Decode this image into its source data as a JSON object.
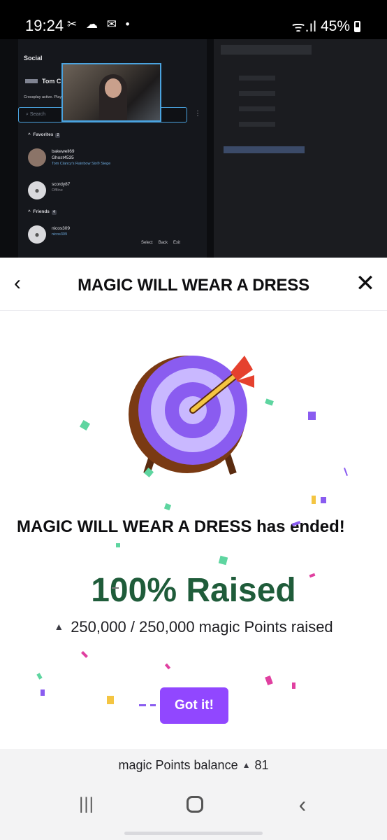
{
  "status_bar": {
    "time": "19:24",
    "notification_icons": "✂ ☁ ✉ •",
    "signal": "ᯤ.ıl",
    "battery": "45%"
  },
  "stream": {
    "social_title": "Social",
    "game_title": "Tom Clancy's Rainbow Six® Siege",
    "crossplay_text": "Crossplay active. Players from other platforms can be invited.",
    "search_placeholder": "Search",
    "favorites_label": "Favorites",
    "favorites_count": "2",
    "friends_label": "Friends",
    "friends_count": "4",
    "favorites": [
      {
        "name": "bakewell69",
        "secondary": "Ghost4535",
        "status": "Tom Clancy's Rainbow Six® Siege"
      },
      {
        "name": "scordy87",
        "status": "Offline"
      }
    ],
    "friends": [
      {
        "name": "nicos309",
        "secondary": "nicos309"
      }
    ],
    "hints": [
      "Select",
      "Back",
      "Exit"
    ]
  },
  "modal": {
    "title": "MAGIC WILL WEAR A DRESS",
    "ended_text": "MAGIC WILL WEAR A DRESS has ended!",
    "raised_text": "100% Raised",
    "points_text": "250,000 / 250,000 magic Points raised",
    "points_raised": 250000,
    "points_goal": 250000,
    "button_label": "Got it!"
  },
  "balance": {
    "label": "magic Points balance",
    "value": "81"
  },
  "colors": {
    "accent": "#9147ff",
    "raised_green": "#1f5c3a",
    "target_purple": "#8a5cf0",
    "arrow_red": "#e5412e"
  },
  "icons": {
    "back": "chevron-left-icon",
    "close": "close-icon",
    "points": "channel-points-icon",
    "target": "bullseye-target-icon"
  }
}
